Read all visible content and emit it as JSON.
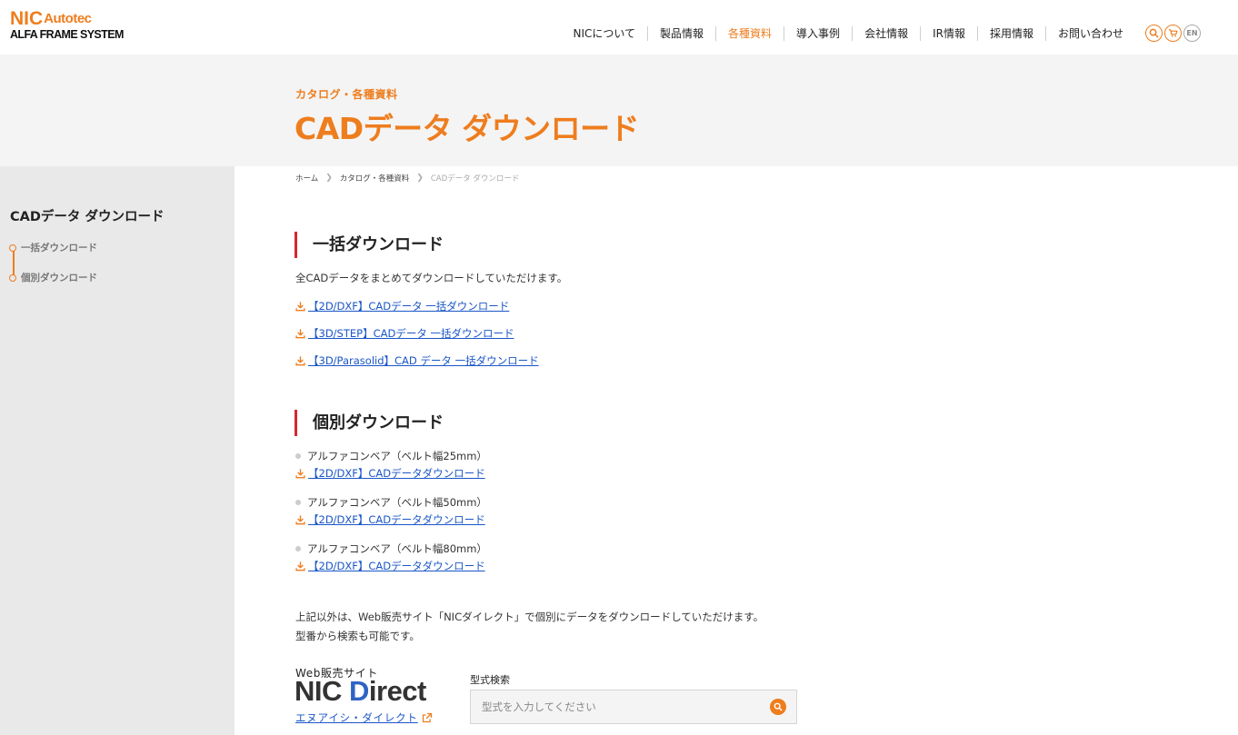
{
  "header": {
    "logo": {
      "line1_main": "NIC",
      "line1_sub": "Autotec",
      "line2": "ALFA FRAME SYSTEM"
    },
    "nav": [
      {
        "label": "NICについて",
        "active": false
      },
      {
        "label": "製品情報",
        "active": false
      },
      {
        "label": "各種資料",
        "active": true
      },
      {
        "label": "導入事例",
        "active": false
      },
      {
        "label": "会社情報",
        "active": false
      },
      {
        "label": "IR情報",
        "active": false
      },
      {
        "label": "採用情報",
        "active": false
      },
      {
        "label": "お問い合わせ",
        "active": false
      }
    ],
    "icons": [
      "search-icon",
      "cart-icon",
      "language-icon"
    ],
    "language_label": "EN"
  },
  "hero": {
    "subtitle": "カタログ・各種資料",
    "title": "CADデータ ダウンロード"
  },
  "sidebar": {
    "title": "CADデータ ダウンロード",
    "items": [
      {
        "label": "一括ダウンロード"
      },
      {
        "label": "個別ダウンロード"
      }
    ]
  },
  "breadcrumb": [
    {
      "label": "ホーム"
    },
    {
      "label": "カタログ・各種資料"
    },
    {
      "label": "CADデータ ダウンロード"
    }
  ],
  "bulk": {
    "heading": "一括ダウンロード",
    "description": "全CADデータをまとめてダウンロードしていただけます。",
    "links": [
      {
        "label": "【2D/DXF】CADデータ 一括ダウンロード"
      },
      {
        "label": "【3D/STEP】CADデータ 一括ダウンロード"
      },
      {
        "label": "【3D/Parasolid】CAD データ 一括ダウンロード"
      }
    ]
  },
  "individual": {
    "heading": "個別ダウンロード",
    "items": [
      {
        "name": "アルファコンベア（ベルト幅25mm）",
        "link": "【2D/DXF】CADデータダウンロード"
      },
      {
        "name": "アルファコンベア（ベルト幅50mm）",
        "link": "【2D/DXF】CADデータダウンロード"
      },
      {
        "name": "アルファコンベア（ベルト幅80mm）",
        "link": "【2D/DXF】CADデータダウンロード"
      }
    ]
  },
  "other": {
    "line1": "上記以外は、Web販売サイト「NICダイレクト」で個別にデータをダウンロードしていただけます。",
    "line2": "型番から検索も可能です。"
  },
  "nic_direct": {
    "subtitle": "Web販売サイト",
    "logo_part1": "NIC ",
    "logo_part2": "D",
    "logo_part3": "irect",
    "link_label": "エヌアイシ・ダイレクト"
  },
  "search": {
    "label": "型式検索",
    "placeholder": "型式を入力してください"
  },
  "colors": {
    "accent": "#ee7d1e",
    "link": "#1a56c7",
    "heading_bar": "#d7262e"
  }
}
